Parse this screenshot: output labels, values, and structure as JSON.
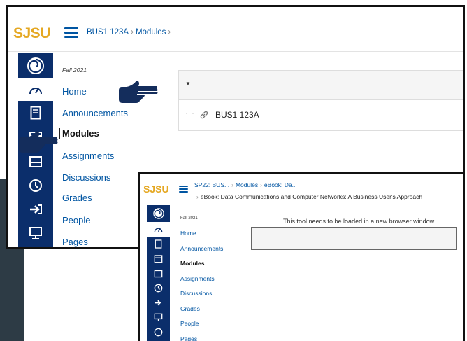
{
  "screen1": {
    "logo": "SJSU",
    "breadcrumb": [
      "BUS1 123A",
      "Modules"
    ],
    "term": "Fall 2021",
    "course_nav": [
      "Home",
      "Announcements",
      "Modules",
      "Assignments",
      "Discussions",
      "Grades",
      "People",
      "Pages"
    ],
    "active_nav": "Modules",
    "module_item": "BUS1 123A"
  },
  "screen2": {
    "logo": "SJSU",
    "breadcrumb_line1": [
      "SP22: BUS...",
      "Modules",
      "eBook: Da..."
    ],
    "breadcrumb_line2": "eBook: Data Communications and Computer Networks: A Business User's Approach",
    "term": "Fall 2021",
    "course_nav": [
      "Home",
      "Announcements",
      "Modules",
      "Assignments",
      "Discussions",
      "Grades",
      "People",
      "Pages"
    ],
    "active_nav": "Modules",
    "tool_message": "This tool needs to be loaded in a new browser window"
  },
  "global_nav_icons": [
    "spiral-logo-icon",
    "dashboard-icon",
    "courses-icon",
    "calendar-icon",
    "inbox-icon",
    "history-icon",
    "commons-icon",
    "studio-icon",
    "help-icon"
  ],
  "colors": {
    "sjsu_gold": "#e5a823",
    "link_blue": "#0055a2",
    "nav_navy": "#0b2e6b",
    "hand_navy": "#142d5c"
  }
}
